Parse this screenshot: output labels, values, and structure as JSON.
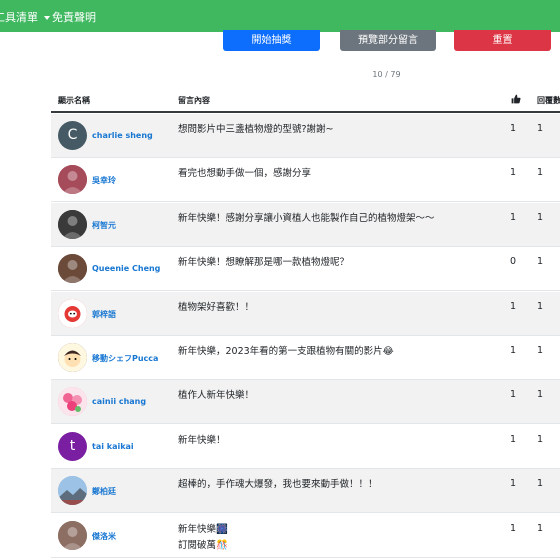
{
  "navbar": {
    "tools_label": "工具清單",
    "disclaimer_label": "免責聲明"
  },
  "buttons": {
    "start": "開始抽獎",
    "preview": "預覽部分留言",
    "reset": "重置"
  },
  "pagination": {
    "text": "10 / 79"
  },
  "table": {
    "headers": {
      "name": "顯示名稱",
      "comment": "留言內容",
      "like_icon": "thumbs-up-icon",
      "reply": "回覆數"
    },
    "rows": [
      {
        "name": "charlie sheng",
        "avatar": {
          "letter": "C",
          "color": "#455a64"
        },
        "comment": [
          "想問影片中三盞植物燈的型號?謝謝~"
        ],
        "likes": "1",
        "replies": "1"
      },
      {
        "name": "吳幸玲",
        "avatar": {
          "icon": "photo-avatar",
          "color": "#a64b5a"
        },
        "comment": [
          "看完也想動手做一個，感謝分享"
        ],
        "likes": "1",
        "replies": "1"
      },
      {
        "name": "柯智元",
        "avatar": {
          "icon": "photo-avatar",
          "color": "#3a3a3a"
        },
        "comment": [
          "新年快樂！感謝分享讓小資植人也能製作自己的植物燈架～～"
        ],
        "likes": "1",
        "replies": "1"
      },
      {
        "name": "Queenie Cheng",
        "avatar": {
          "icon": "photo-avatar",
          "color": "#6b4a3a"
        },
        "comment": [
          "新年快樂！想瞭解那是哪一款植物燈呢？"
        ],
        "likes": "0",
        "replies": "1"
      },
      {
        "name": "郭梓語",
        "avatar": {
          "icon": "daruma-avatar",
          "color": "#e53935"
        },
        "comment": [
          "植物架好喜歡！！"
        ],
        "likes": "1",
        "replies": "1"
      },
      {
        "name": "移動シェフPucca",
        "avatar": {
          "icon": "cartoon-avatar",
          "color": "#5b3a29"
        },
        "comment": [
          "新年快樂，2023年看的第一支跟植物有關的影片😂"
        ],
        "likes": "1",
        "replies": "1"
      },
      {
        "name": "cainii chang",
        "avatar": {
          "icon": "flower-avatar",
          "color": "#f48fb1"
        },
        "comment": [
          "植作人新年快樂！"
        ],
        "likes": "1",
        "replies": "1"
      },
      {
        "name": "tai kaikai",
        "avatar": {
          "letter": "t",
          "color": "#7b1fa2"
        },
        "comment": [
          "新年快樂！"
        ],
        "likes": "1",
        "replies": "1"
      },
      {
        "name": "鄭柏廷",
        "avatar": {
          "icon": "landscape-avatar",
          "color": "#7fa7c9"
        },
        "comment": [
          "超棒的，手作魂大爆發，我也要來動手做！！！"
        ],
        "likes": "1",
        "replies": "1"
      },
      {
        "name": "傑洛米",
        "avatar": {
          "icon": "photo-avatar",
          "color": "#8d6e63"
        },
        "comment": [
          "新年快樂🎆",
          "訂閱破萬🎊"
        ],
        "likes": "1",
        "replies": "1"
      }
    ]
  }
}
